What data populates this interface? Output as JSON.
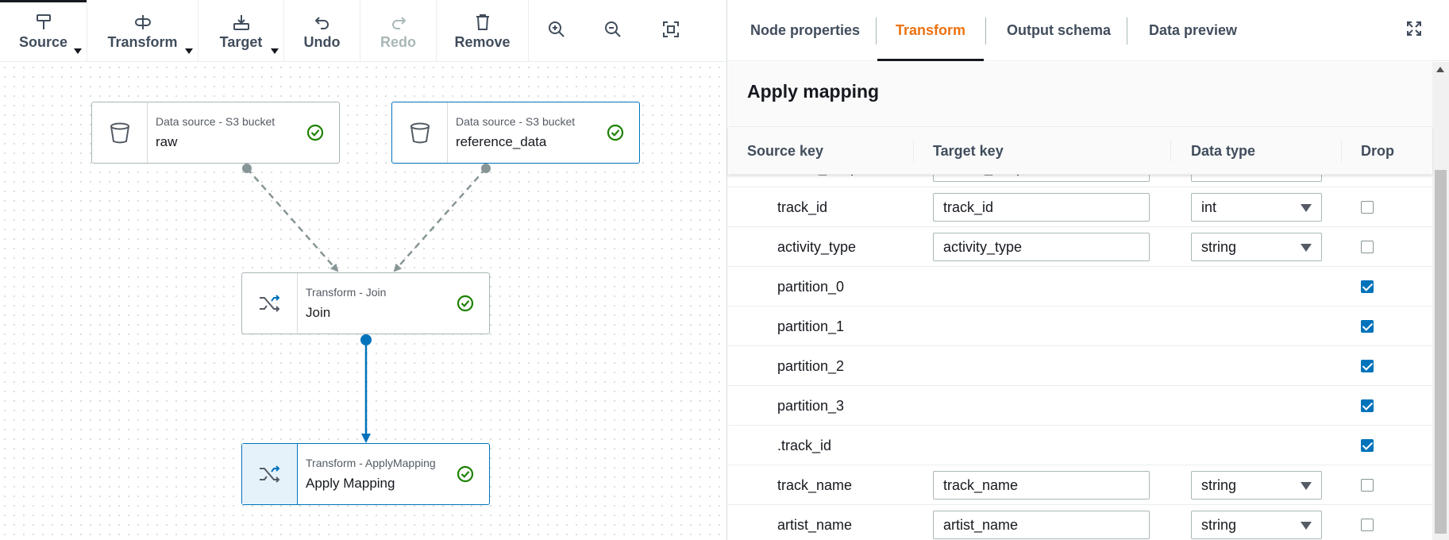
{
  "toolbar": {
    "source_label": "Source",
    "transform_label": "Transform",
    "target_label": "Target",
    "undo_label": "Undo",
    "redo_label": "Redo",
    "remove_label": "Remove"
  },
  "nodes": {
    "raw": {
      "subtitle": "Data source - S3 bucket",
      "name": "raw"
    },
    "reference": {
      "subtitle": "Data source - S3 bucket",
      "name": "reference_data"
    },
    "join": {
      "subtitle": "Transform - Join",
      "name": "Join"
    },
    "apply": {
      "subtitle": "Transform - ApplyMapping",
      "name": "Apply Mapping"
    }
  },
  "tabs": [
    "Node properties",
    "Transform",
    "Output schema",
    "Data preview"
  ],
  "panel": {
    "title": "Apply mapping",
    "columns": [
      "Source key",
      "Target key",
      "Data type",
      "Drop"
    ]
  },
  "rows": [
    {
      "source": "device_temp",
      "target": "device_temp",
      "type": "int",
      "drop": false
    },
    {
      "source": "track_id",
      "target": "track_id",
      "type": "int",
      "drop": false
    },
    {
      "source": "activity_type",
      "target": "activity_type",
      "type": "string",
      "drop": false
    },
    {
      "source": "partition_0",
      "target": null,
      "type": null,
      "drop": true
    },
    {
      "source": "partition_1",
      "target": null,
      "type": null,
      "drop": true
    },
    {
      "source": "partition_2",
      "target": null,
      "type": null,
      "drop": true
    },
    {
      "source": "partition_3",
      "target": null,
      "type": null,
      "drop": true
    },
    {
      "source": ".track_id",
      "target": null,
      "type": null,
      "drop": true
    },
    {
      "source": "track_name",
      "target": "track_name",
      "type": "string",
      "drop": false
    },
    {
      "source": "artist_name",
      "target": "artist_name",
      "type": "string",
      "drop": false
    }
  ],
  "colors": {
    "accent": "#ec7211",
    "blue": "#0073bb",
    "success": "#1d8102"
  },
  "icons": {
    "source": "source-icon",
    "transform": "transform-icon",
    "target": "target-icon",
    "undo": "undo-icon",
    "redo": "redo-icon",
    "remove": "trash-icon",
    "zoom_in": "zoom-in-icon",
    "zoom_out": "zoom-out-icon",
    "fit": "fit-to-screen-icon",
    "bucket": "bucket-icon",
    "shuffle": "shuffle-icon",
    "check": "check-circle-icon",
    "expand": "expand-icon"
  }
}
